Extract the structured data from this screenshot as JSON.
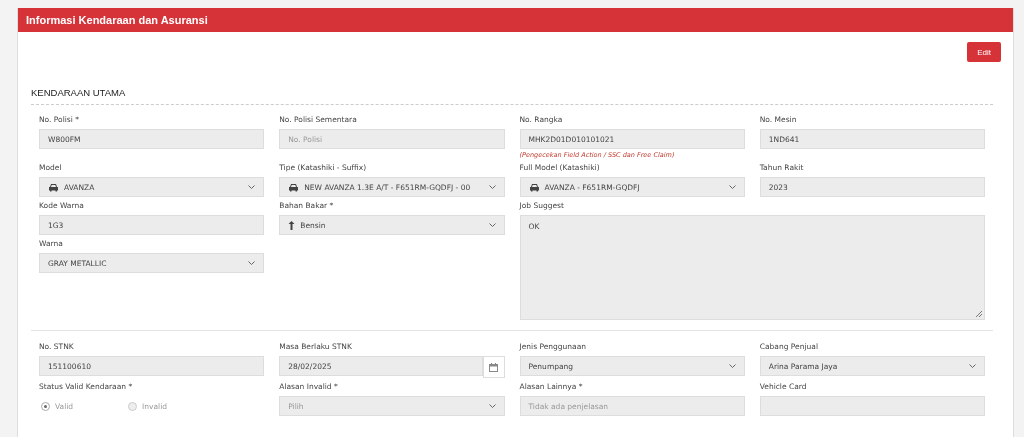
{
  "panel": {
    "title": "Informasi Kendaraan dan Asuransi",
    "edit_button": "Edit"
  },
  "section": {
    "title": "KENDARAAN UTAMA"
  },
  "groups": [
    {
      "fields": [
        {
          "kind": "text",
          "label": "No. Polisi *",
          "value": "W800FM"
        },
        {
          "kind": "text",
          "label": "No. Polisi Sementara",
          "placeholder": "No. Polisi"
        },
        {
          "kind": "text",
          "label": "No. Rangka",
          "value": "MHK2D01D010101021",
          "note": "(Pengecekan Field Action / SSC dan Free Claim)"
        },
        {
          "kind": "text",
          "label": "No. Mesin",
          "value": "1ND641"
        },
        {
          "kind": "vehicle-select",
          "label": "Model",
          "value": "AVANZA"
        },
        {
          "kind": "vehicle-select",
          "label": "Tipe (Katashiki - Suffix)",
          "value": "NEW AVANZA 1.3E A/T - F651RM-GQDFJ - 00"
        },
        {
          "kind": "vehicle-select",
          "label": "Full Model (Katashiki)",
          "value": "AVANZA - F651RM-GQDFJ"
        },
        {
          "kind": "text",
          "label": "Tahun Rakit",
          "value": "2023"
        },
        {
          "kind": "text",
          "label": "Kode Warna",
          "value": "1G3"
        },
        {
          "kind": "fuel-select",
          "label": "Bahan Bakar *",
          "value": "Bensin"
        },
        {
          "kind": "textarea",
          "label": "Job Suggest",
          "value": "OK"
        },
        {
          "kind": "select",
          "label": "Warna",
          "value": "GRAY METALLIC"
        }
      ]
    },
    {
      "fields": [
        {
          "kind": "text",
          "label": "No. STNK",
          "value": "151100610"
        },
        {
          "kind": "date",
          "label": "Masa Berlaku STNK",
          "value": "28/02/2025"
        },
        {
          "kind": "select",
          "label": "Jenis Penggunaan",
          "value": "Penumpang"
        },
        {
          "kind": "select",
          "label": "Cabang Penjual",
          "value": "Arina Parama Jaya"
        },
        {
          "kind": "radio",
          "label": "Status Valid Kendaraan *",
          "options": [
            {
              "label": "Valid",
              "selected": true
            },
            {
              "label": "Invalid",
              "selected": false
            }
          ]
        },
        {
          "kind": "select",
          "label": "Alasan Invalid *",
          "placeholder": "Pilih"
        },
        {
          "kind": "text",
          "label": "Alasan Lainnya *",
          "placeholder": "Tidak ada penjelasan"
        },
        {
          "kind": "text",
          "label": "Vehicle Card"
        }
      ]
    }
  ]
}
